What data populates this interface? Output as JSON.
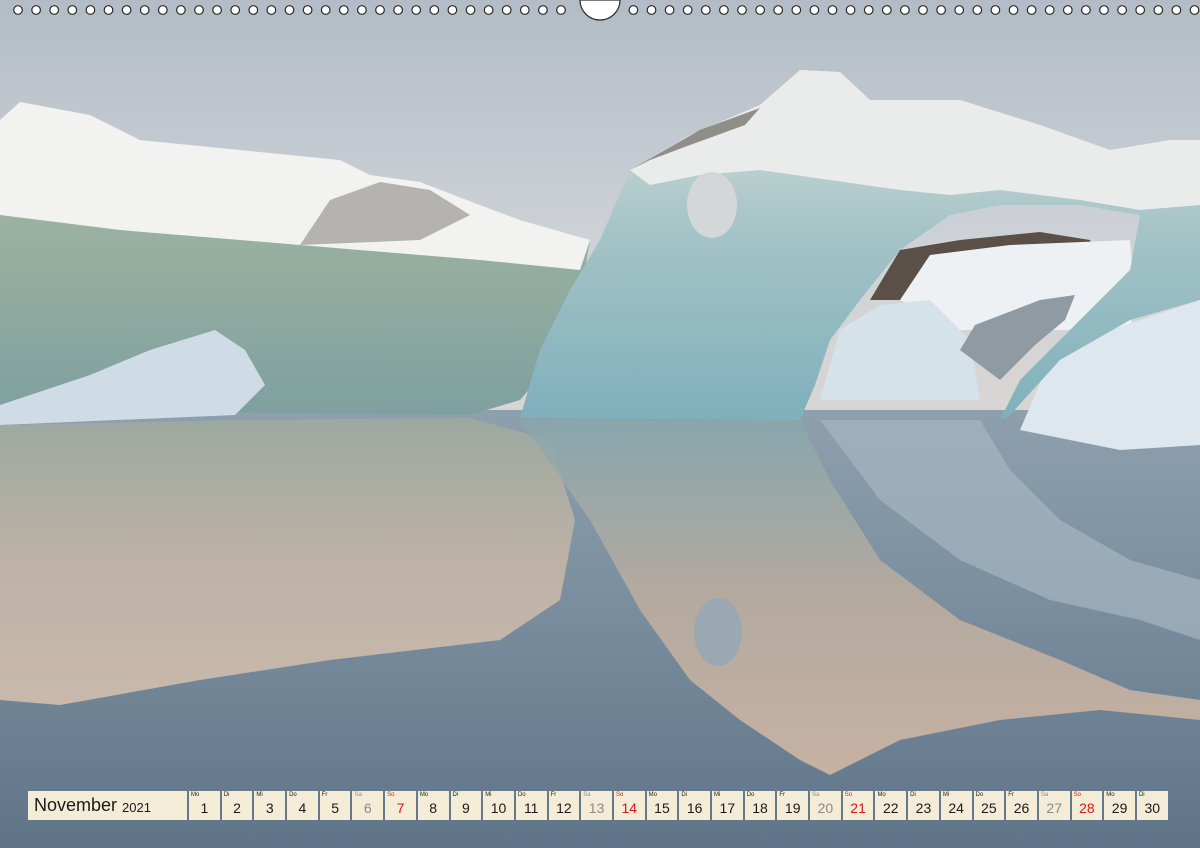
{
  "calendar": {
    "month": "November",
    "year": "2021",
    "days": [
      {
        "wd": "Mo",
        "d": "1",
        "type": "weekday"
      },
      {
        "wd": "Di",
        "d": "2",
        "type": "weekday"
      },
      {
        "wd": "Mi",
        "d": "3",
        "type": "weekday"
      },
      {
        "wd": "Do",
        "d": "4",
        "type": "weekday"
      },
      {
        "wd": "Fr",
        "d": "5",
        "type": "weekday"
      },
      {
        "wd": "Sa",
        "d": "6",
        "type": "sat"
      },
      {
        "wd": "So",
        "d": "7",
        "type": "sun"
      },
      {
        "wd": "Mo",
        "d": "8",
        "type": "weekday"
      },
      {
        "wd": "Di",
        "d": "9",
        "type": "weekday"
      },
      {
        "wd": "Mi",
        "d": "10",
        "type": "weekday"
      },
      {
        "wd": "Do",
        "d": "11",
        "type": "weekday"
      },
      {
        "wd": "Fr",
        "d": "12",
        "type": "weekday"
      },
      {
        "wd": "Sa",
        "d": "13",
        "type": "sat"
      },
      {
        "wd": "So",
        "d": "14",
        "type": "sun"
      },
      {
        "wd": "Mo",
        "d": "15",
        "type": "weekday"
      },
      {
        "wd": "Di",
        "d": "16",
        "type": "weekday"
      },
      {
        "wd": "Mi",
        "d": "17",
        "type": "weekday"
      },
      {
        "wd": "Do",
        "d": "18",
        "type": "weekday"
      },
      {
        "wd": "Fr",
        "d": "19",
        "type": "weekday"
      },
      {
        "wd": "Sa",
        "d": "20",
        "type": "sat"
      },
      {
        "wd": "So",
        "d": "21",
        "type": "sun"
      },
      {
        "wd": "Mo",
        "d": "22",
        "type": "weekday"
      },
      {
        "wd": "Di",
        "d": "23",
        "type": "weekday"
      },
      {
        "wd": "Mi",
        "d": "24",
        "type": "weekday"
      },
      {
        "wd": "Do",
        "d": "25",
        "type": "weekday"
      },
      {
        "wd": "Fr",
        "d": "26",
        "type": "weekday"
      },
      {
        "wd": "Sa",
        "d": "27",
        "type": "sat"
      },
      {
        "wd": "So",
        "d": "28",
        "type": "sun"
      },
      {
        "wd": "Mo",
        "d": "29",
        "type": "weekday"
      },
      {
        "wd": "Di",
        "d": "30",
        "type": "weekday"
      }
    ]
  },
  "colors": {
    "strip_bg": "#f4ecd6",
    "sunday": "#d11a1a",
    "saturday": "#8a8a8a",
    "text": "#1a1a1a"
  },
  "icons": {
    "binding": "spiral-binding-rings",
    "hanger": "hanger-notch"
  }
}
